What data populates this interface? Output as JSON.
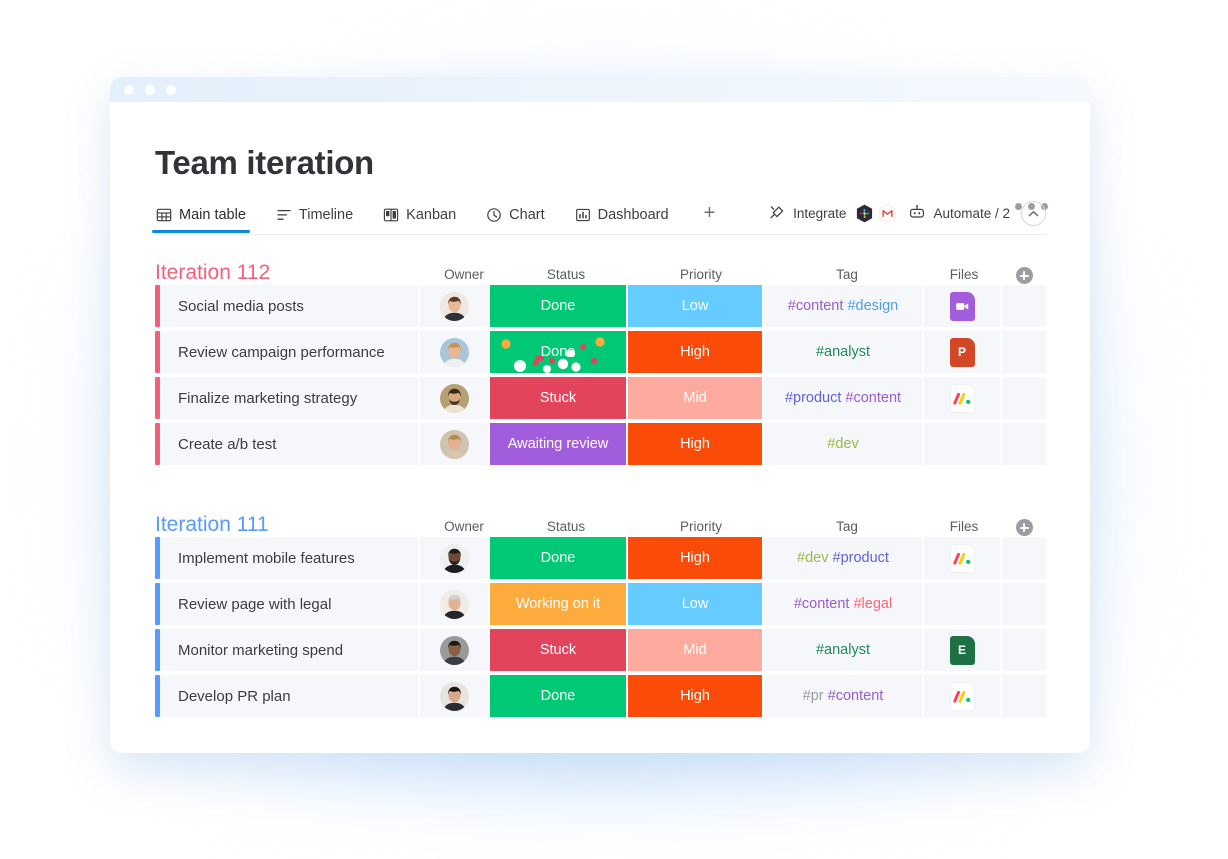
{
  "window": {
    "traffic_lights": [
      "dot-1",
      "dot-2",
      "dot-3"
    ]
  },
  "header": {
    "title": "Team iteration",
    "menu_icon": "kebab-menu-icon"
  },
  "tabs": [
    {
      "label": "Main table",
      "icon": "table-icon",
      "active": true
    },
    {
      "label": "Timeline",
      "icon": "timeline-icon",
      "active": false
    },
    {
      "label": "Kanban",
      "icon": "kanban-icon",
      "active": false
    },
    {
      "label": "Chart",
      "icon": "clock-icon",
      "active": false
    },
    {
      "label": "Dashboard",
      "icon": "dashboard-icon",
      "active": false
    }
  ],
  "add_tab_label": "+",
  "toolbar": {
    "integrate_label": "Integrate",
    "integrate_icon": "integrate-icon",
    "app_icons": [
      "slack-icon",
      "gmail-icon"
    ],
    "automate_label": "Automate / 2",
    "automate_icon": "robot-icon",
    "collapse_icon": "chevron-up-icon"
  },
  "columns": [
    "Owner",
    "Status",
    "Priority",
    "Tag",
    "Files"
  ],
  "colors": {
    "accent_blue": "#0f88e5",
    "group_112": "#f65f7c",
    "group_111": "#579bfc",
    "done": "#00c875",
    "stuck": "#e2445c",
    "working": "#fdab3d",
    "awaiting": "#a25ddc",
    "high": "#fb4b08",
    "mid": "#fdab9e",
    "low": "#66ccff",
    "cell_bg": "#f6f7fb"
  },
  "tag_colors": {
    "content": "#9a5ccc",
    "design": "#4f9dea",
    "analyst": "#1e8a5a",
    "product": "#6161d8",
    "dev": "#9ab845",
    "legal": "#f munged",
    "legal_hex": "#f76a71",
    "pr": "#9b9da5"
  },
  "groups": [
    {
      "name": "Iteration 112",
      "color": "#f65f7c",
      "bar_color": "#f65f7c",
      "rows": [
        {
          "name": "Social media posts",
          "owner": "avatar-woman-brown-hair",
          "status": {
            "label": "Done",
            "color": "#00c875"
          },
          "priority": {
            "label": "Low",
            "color": "#66ccff"
          },
          "tags": [
            {
              "text": "#content",
              "color": "#9a5ccc"
            },
            {
              "text": "#design",
              "color": "#4f9dea"
            }
          ],
          "file": {
            "type": "video-file-icon",
            "color": "#a25ddc",
            "glyph": "video"
          },
          "celebrating": false
        },
        {
          "name": "Review campaign performance",
          "owner": "avatar-woman-blonde-curly",
          "status": {
            "label": "Done",
            "color": "#00c875"
          },
          "priority": {
            "label": "High",
            "color": "#fb4b08"
          },
          "tags": [
            {
              "text": "#analyst",
              "color": "#1e8a5a"
            }
          ],
          "file": {
            "type": "powerpoint-file-icon",
            "color": "#d24726",
            "glyph": "P"
          },
          "celebrating": true
        },
        {
          "name": "Finalize marketing strategy",
          "owner": "avatar-man-beard",
          "status": {
            "label": "Stuck",
            "color": "#e2445c"
          },
          "priority": {
            "label": "Mid",
            "color": "#fdab9e"
          },
          "tags": [
            {
              "text": "#product",
              "color": "#6161d8"
            },
            {
              "text": "#content",
              "color": "#9a5ccc"
            }
          ],
          "file": {
            "type": "monday-file-icon",
            "color": "#ffffff",
            "glyph": "monday"
          },
          "celebrating": false
        },
        {
          "name": "Create a/b test",
          "owner": "avatar-woman-hat",
          "status": {
            "label": "Awaiting review",
            "color": "#a25ddc"
          },
          "priority": {
            "label": "High",
            "color": "#fb4b08"
          },
          "tags": [
            {
              "text": "#dev",
              "color": "#9ab845"
            }
          ],
          "file": null,
          "celebrating": false
        }
      ]
    },
    {
      "name": "Iteration 111",
      "color": "#579bfc",
      "bar_color": "#579bfc",
      "rows": [
        {
          "name": "Implement mobile features",
          "owner": "avatar-man-dark-skin",
          "status": {
            "label": "Done",
            "color": "#00c875"
          },
          "priority": {
            "label": "High",
            "color": "#fb4b08"
          },
          "tags": [
            {
              "text": "#dev",
              "color": "#9ab845"
            },
            {
              "text": "#product",
              "color": "#6161d8"
            }
          ],
          "file": {
            "type": "monday-file-icon",
            "color": "#ffffff",
            "glyph": "monday"
          },
          "celebrating": false
        },
        {
          "name": "Review page with legal",
          "owner": "avatar-man-grey-hair",
          "status": {
            "label": "Working on it",
            "color": "#fdab3d"
          },
          "priority": {
            "label": "Low",
            "color": "#66ccff"
          },
          "tags": [
            {
              "text": "#content",
              "color": "#9a5ccc"
            },
            {
              "text": "#legal",
              "color": "#f76a71"
            }
          ],
          "file": null,
          "celebrating": false
        },
        {
          "name": "Monitor marketing spend",
          "owner": "avatar-woman-dark-hair",
          "status": {
            "label": "Stuck",
            "color": "#e2445c"
          },
          "priority": {
            "label": "Mid",
            "color": "#fdab9e"
          },
          "tags": [
            {
              "text": "#analyst",
              "color": "#1e8a5a"
            }
          ],
          "file": {
            "type": "excel-file-icon",
            "color": "#1e7145",
            "glyph": "E"
          },
          "celebrating": false
        },
        {
          "name": "Develop PR plan",
          "owner": "avatar-woman-black-hair",
          "status": {
            "label": "Done",
            "color": "#00c875"
          },
          "priority": {
            "label": "High",
            "color": "#fb4b08"
          },
          "tags": [
            {
              "text": "#pr",
              "color": "#9b9da5"
            },
            {
              "text": "#content",
              "color": "#9a5ccc"
            }
          ],
          "file": {
            "type": "monday-file-icon",
            "color": "#ffffff",
            "glyph": "monday"
          },
          "celebrating": false
        }
      ]
    }
  ]
}
